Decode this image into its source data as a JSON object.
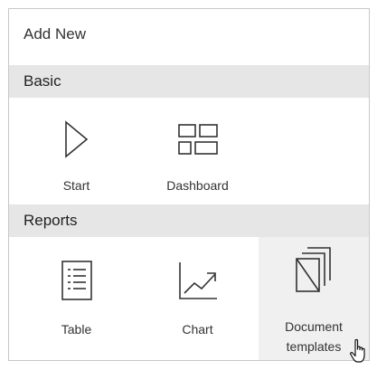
{
  "panel": {
    "title": "Add New"
  },
  "sections": [
    {
      "title": "Basic",
      "items": [
        {
          "label_line1": "Start",
          "label_line2": "",
          "icon": "play-triangle-icon"
        },
        {
          "label_line1": "Dashboard",
          "label_line2": "",
          "icon": "dashboard-grid-icon"
        }
      ]
    },
    {
      "title": "Reports",
      "items": [
        {
          "label_line1": "Table",
          "label_line2": "",
          "icon": "table-list-icon"
        },
        {
          "label_line1": "Chart",
          "label_line2": "",
          "icon": "line-chart-icon"
        },
        {
          "label_line1": "Document",
          "label_line2": "templates",
          "icon": "document-templates-icon"
        }
      ]
    }
  ],
  "colors": {
    "section_header_bg": "#e6e6e6",
    "hover_tile_bg": "#f0f0f0",
    "icon_stroke": "#333333",
    "border": "#c8c8c8"
  }
}
